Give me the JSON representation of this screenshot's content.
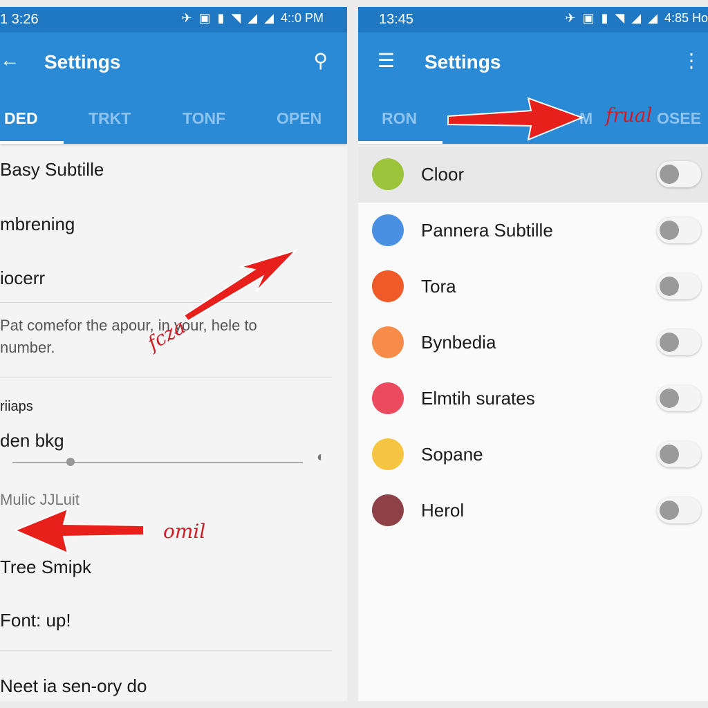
{
  "left": {
    "status": {
      "time": "1 3:26",
      "clock": "4::0 PM"
    },
    "appbar": {
      "back_icon": "arrow-left",
      "title": "Settings",
      "search_icon": "search"
    },
    "tabs": [
      "DED",
      "TRKT",
      "TONF",
      "OPEN"
    ],
    "items": [
      "Basy Subtille",
      "mbrening",
      "iocerr"
    ],
    "paragraph": "Pat comefor the apour, in your, hele to number.",
    "section": "riiaps",
    "slider": {
      "label": "den bkg",
      "value_fraction": 0.2
    },
    "subhead": "Mulic JJLuit",
    "items2": [
      "Tree Smipk",
      "Font: up!"
    ],
    "last": "Neet ia sen-ory do",
    "annotations": [
      "fcza",
      "omil"
    ]
  },
  "right": {
    "status": {
      "time": "13:45",
      "clock": "4:85 Ho"
    },
    "appbar": {
      "menu_icon": "hamburger",
      "title": "Settings",
      "more_icon": "dots-vertical"
    },
    "tabs": [
      "RON",
      "M",
      "OSEE"
    ],
    "annotation": "frual",
    "rows": [
      {
        "label": "Cloor",
        "color": "#9bc43a",
        "on": false
      },
      {
        "label": "Pannera Subtille",
        "color": "#4a90e2",
        "on": false
      },
      {
        "label": "Tora",
        "color": "#f05a28",
        "on": false
      },
      {
        "label": "Bynbedia",
        "color": "#f78c4a",
        "on": false
      },
      {
        "label": "Elmtih surates",
        "color": "#ec4a5e",
        "on": false
      },
      {
        "label": "Sopane",
        "color": "#f5c542",
        "on": false
      },
      {
        "label": "Herol",
        "color": "#8e4248",
        "on": false
      }
    ]
  },
  "colors": {
    "appbar": "#2b8ad6",
    "statusbar": "#1f78c1",
    "arrow": "#e8201c"
  }
}
